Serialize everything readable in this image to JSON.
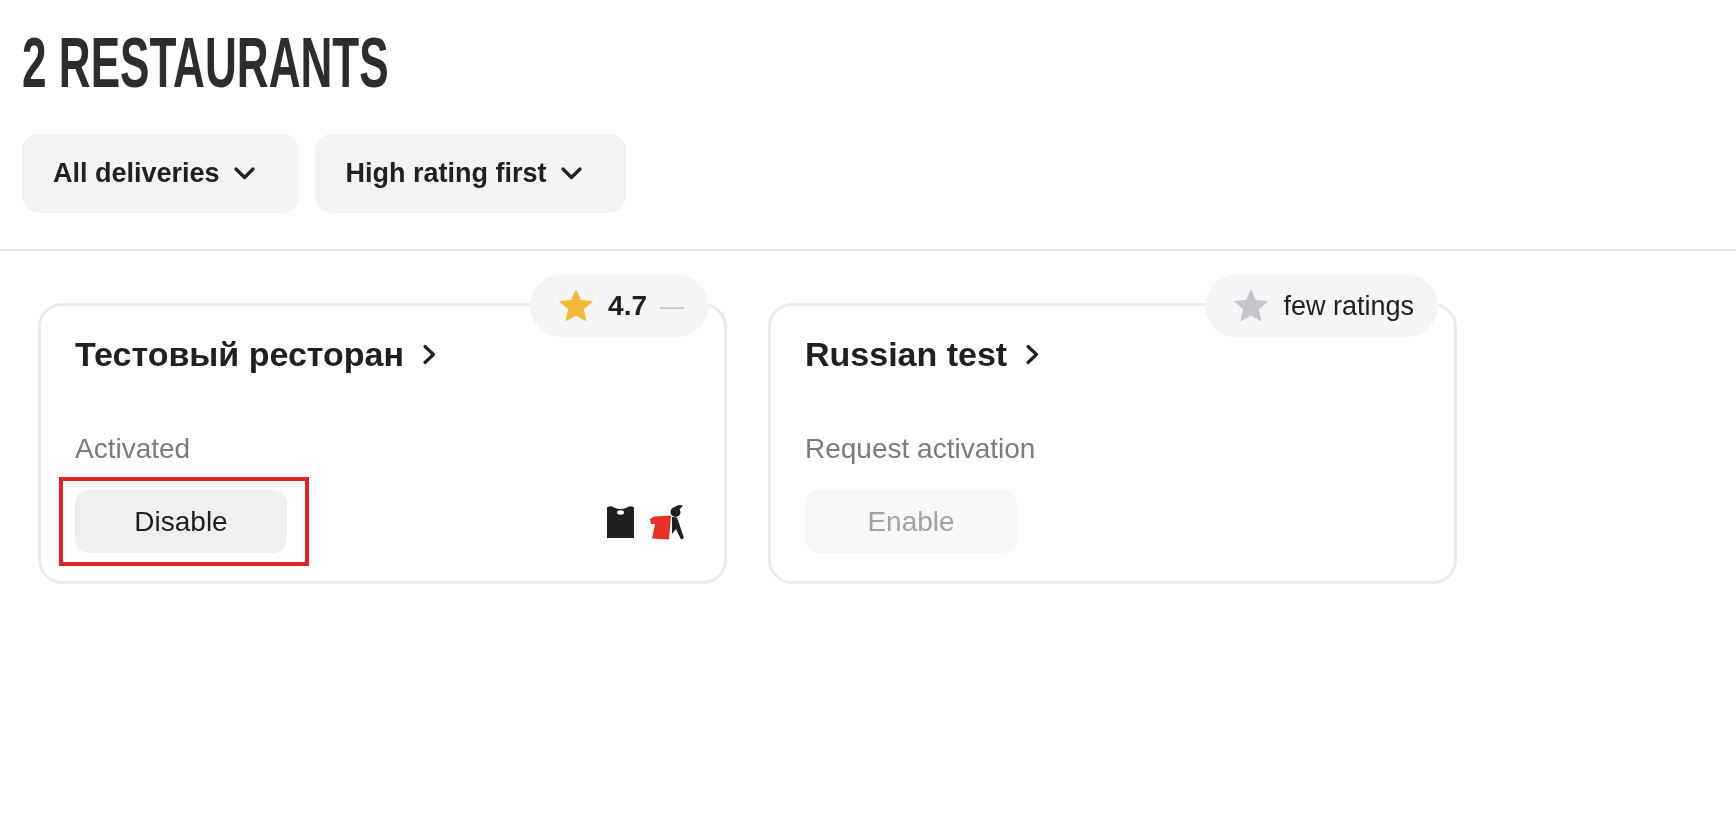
{
  "title": "2 RESTAURANTS",
  "filters": [
    {
      "label": "All deliveries"
    },
    {
      "label": "High rating first"
    }
  ],
  "restaurants": [
    {
      "name": "Тестовый ресторан",
      "rating": {
        "kind": "rated",
        "label": "4.7",
        "trend": "—"
      },
      "status": "Activated",
      "button": {
        "label": "Disable",
        "disabled": false,
        "highlighted": true
      },
      "delivery_icons": [
        {
          "kind": "bag"
        },
        {
          "kind": "courier"
        }
      ]
    },
    {
      "name": "Russian test",
      "rating": {
        "kind": "unrated",
        "label": "few ratings"
      },
      "status": "Request activation",
      "button": {
        "label": "Enable",
        "disabled": true,
        "highlighted": false
      }
    }
  ]
}
